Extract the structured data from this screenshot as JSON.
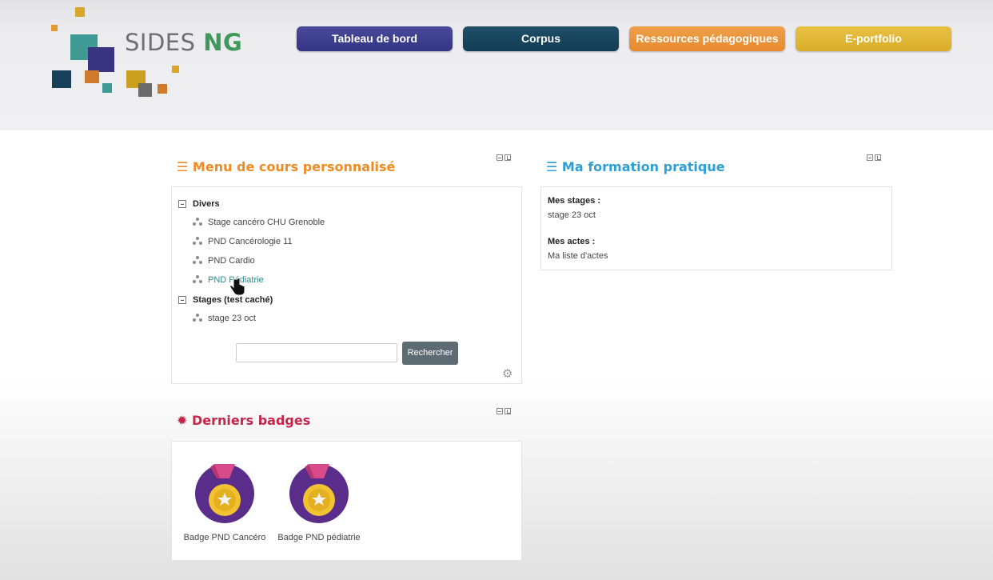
{
  "header": {
    "logo": {
      "text_main": "SIDES",
      "text_accent": "NG"
    },
    "nav": [
      {
        "label": "Tableau de bord",
        "color": "#3a3a8c"
      },
      {
        "label": "Corpus",
        "color": "#164458"
      },
      {
        "label": "Ressources pédagogiques",
        "color": "#ea952f"
      },
      {
        "label": "E-portfolio",
        "color": "#e0b532"
      }
    ]
  },
  "menu_block": {
    "title": "Menu de cours personnalisé",
    "title_color": "#ef8b22",
    "groups": [
      {
        "label": "Divers",
        "items": [
          "Stage cancéro CHU Grenoble",
          "PND Cancérologie 11",
          "PND Cardio",
          "PND Pédiatrie"
        ]
      },
      {
        "label": "Stages (test caché)",
        "items": [
          "stage 23 oct"
        ]
      }
    ],
    "search": {
      "value": "",
      "placeholder": "",
      "button_label": "Rechercher"
    }
  },
  "formation_block": {
    "title": "Ma formation pratique",
    "title_color": "#2e9fd6",
    "sections": [
      {
        "label": "Mes stages :",
        "value": "stage 23 oct"
      },
      {
        "label": "Mes actes :",
        "value": "Ma liste d'actes"
      }
    ]
  },
  "badges_block": {
    "title": "Derniers badges",
    "title_color": "#c8234a",
    "badges": [
      {
        "label": "Badge PND Cancéro"
      },
      {
        "label": "Badge PND pédiatrie"
      }
    ]
  }
}
